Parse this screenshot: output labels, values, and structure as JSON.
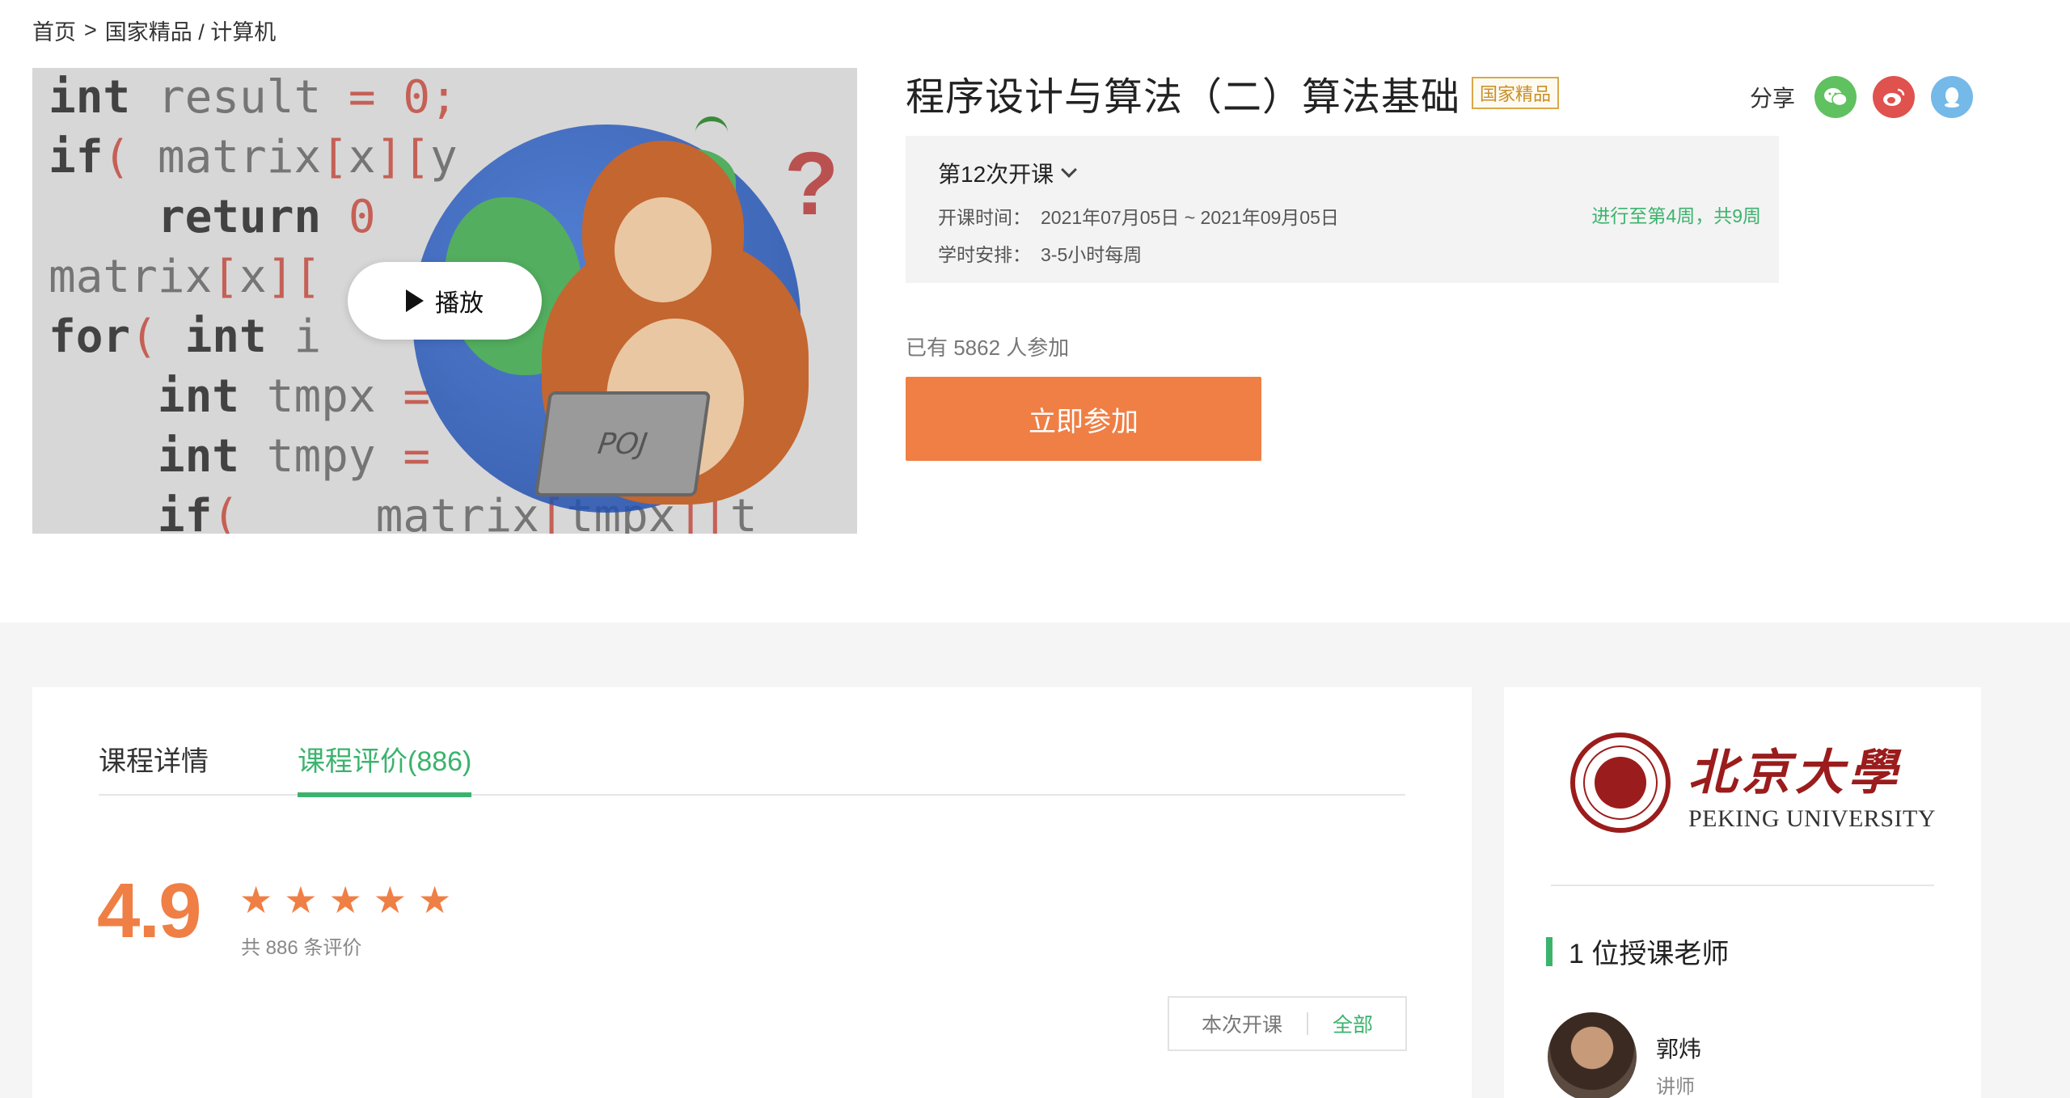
{
  "breadcrumb": {
    "home": "首页",
    "sep": ">",
    "path": "国家精品 / 计算机"
  },
  "video": {
    "play_label": "播放",
    "laptop_text": "POJ",
    "code_lines": [
      "int result = 0;",
      "if( matrix[x][y] ?",
      "    return 0",
      "matrix[x][y]",
      "for( int i",
      "    int tmpx =",
      "    int tmpy =",
      "    if(    matrix[tmpx][t"
    ]
  },
  "course": {
    "title": "程序设计与算法（二）算法基础",
    "badge": "国家精品",
    "share_label": "分享",
    "session": {
      "label": "第12次开课",
      "dates_label": "开课时间：",
      "dates_value": "2021年07月05日 ~ 2021年09月05日",
      "hours_label": "学时安排：",
      "hours_value": "3-5小时每周",
      "progress": "进行至第4周，共9周"
    },
    "participants": "已有 5862 人参加",
    "join_label": "立即参加"
  },
  "tabs": [
    {
      "label": "课程详情"
    },
    {
      "label": "课程评价(886)"
    }
  ],
  "rating": {
    "score": "4.9",
    "stars": 5,
    "count_text": "共 886 条评价",
    "filter": {
      "current": "本次开课",
      "all": "全部"
    }
  },
  "school": {
    "name_cn": "北京大學",
    "name_en": "PEKING UNIVERSITY"
  },
  "teachers": {
    "count_label": "1 位授课老师",
    "list": [
      {
        "name": "郭炜",
        "role": "讲师"
      }
    ]
  },
  "colors": {
    "accent_green": "#3bb36d",
    "accent_orange": "#ef7f45",
    "badge_gold": "#c98f27",
    "seal_red": "#9b1c1c"
  }
}
